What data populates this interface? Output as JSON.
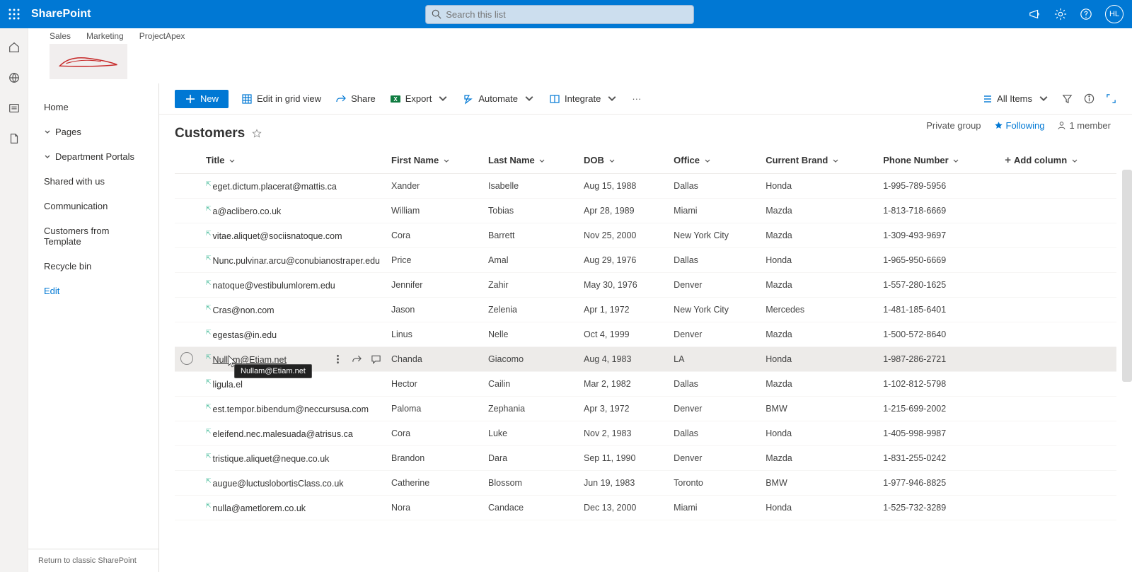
{
  "brand": "SharePoint",
  "search": {
    "placeholder": "Search this list"
  },
  "avatar_initials": "HL",
  "hub_nav": [
    "Sales",
    "Marketing",
    "ProjectApex"
  ],
  "group_privacy": "Private group",
  "following_label": "Following",
  "members_label": "1 member",
  "left_nav": {
    "home": "Home",
    "pages": "Pages",
    "dept": "Department Portals",
    "shared": "Shared with us",
    "comm": "Communication",
    "cust_tmpl": "Customers from Template",
    "recycle": "Recycle bin",
    "edit": "Edit",
    "footer": "Return to classic SharePoint"
  },
  "commands": {
    "new": "New",
    "edit_grid": "Edit in grid view",
    "share": "Share",
    "export": "Export",
    "automate": "Automate",
    "integrate": "Integrate",
    "all_items": "All Items"
  },
  "list_title": "Customers",
  "columns": {
    "title": "Title",
    "first": "First Name",
    "last": "Last Name",
    "dob": "DOB",
    "office": "Office",
    "brand": "Current Brand",
    "phone": "Phone Number",
    "add": "Add column"
  },
  "rows": [
    {
      "title": "eget.dictum.placerat@mattis.ca",
      "first": "Xander",
      "last": "Isabelle",
      "dob": "Aug 15, 1988",
      "office": "Dallas",
      "brand": "Honda",
      "phone": "1-995-789-5956"
    },
    {
      "title": "a@aclibero.co.uk",
      "first": "William",
      "last": "Tobias",
      "dob": "Apr 28, 1989",
      "office": "Miami",
      "brand": "Mazda",
      "phone": "1-813-718-6669"
    },
    {
      "title": "vitae.aliquet@sociisnatoque.com",
      "first": "Cora",
      "last": "Barrett",
      "dob": "Nov 25, 2000",
      "office": "New York City",
      "brand": "Mazda",
      "phone": "1-309-493-9697"
    },
    {
      "title": "Nunc.pulvinar.arcu@conubianostraper.edu",
      "first": "Price",
      "last": "Amal",
      "dob": "Aug 29, 1976",
      "office": "Dallas",
      "brand": "Honda",
      "phone": "1-965-950-6669"
    },
    {
      "title": "natoque@vestibulumlorem.edu",
      "first": "Jennifer",
      "last": "Zahir",
      "dob": "May 30, 1976",
      "office": "Denver",
      "brand": "Mazda",
      "phone": "1-557-280-1625"
    },
    {
      "title": "Cras@non.com",
      "first": "Jason",
      "last": "Zelenia",
      "dob": "Apr 1, 1972",
      "office": "New York City",
      "brand": "Mercedes",
      "phone": "1-481-185-6401"
    },
    {
      "title": "egestas@in.edu",
      "first": "Linus",
      "last": "Nelle",
      "dob": "Oct 4, 1999",
      "office": "Denver",
      "brand": "Mazda",
      "phone": "1-500-572-8640"
    },
    {
      "title": "Nullam@Etiam.net",
      "first": "Chanda",
      "last": "Giacomo",
      "dob": "Aug 4, 1983",
      "office": "LA",
      "brand": "Honda",
      "phone": "1-987-286-2721"
    },
    {
      "title": "ligula.el",
      "first": "Hector",
      "last": "Cailin",
      "dob": "Mar 2, 1982",
      "office": "Dallas",
      "brand": "Mazda",
      "phone": "1-102-812-5798"
    },
    {
      "title": "est.tempor.bibendum@neccursusa.com",
      "first": "Paloma",
      "last": "Zephania",
      "dob": "Apr 3, 1972",
      "office": "Denver",
      "brand": "BMW",
      "phone": "1-215-699-2002"
    },
    {
      "title": "eleifend.nec.malesuada@atrisus.ca",
      "first": "Cora",
      "last": "Luke",
      "dob": "Nov 2, 1983",
      "office": "Dallas",
      "brand": "Honda",
      "phone": "1-405-998-9987"
    },
    {
      "title": "tristique.aliquet@neque.co.uk",
      "first": "Brandon",
      "last": "Dara",
      "dob": "Sep 11, 1990",
      "office": "Denver",
      "brand": "Mazda",
      "phone": "1-831-255-0242"
    },
    {
      "title": "augue@luctuslobortisClass.co.uk",
      "first": "Catherine",
      "last": "Blossom",
      "dob": "Jun 19, 1983",
      "office": "Toronto",
      "brand": "BMW",
      "phone": "1-977-946-8825"
    },
    {
      "title": "nulla@ametlorem.co.uk",
      "first": "Nora",
      "last": "Candace",
      "dob": "Dec 13, 2000",
      "office": "Miami",
      "brand": "Honda",
      "phone": "1-525-732-3289"
    }
  ],
  "hover_row_index": 7,
  "tooltip_text": "Nullam@Etiam.net"
}
